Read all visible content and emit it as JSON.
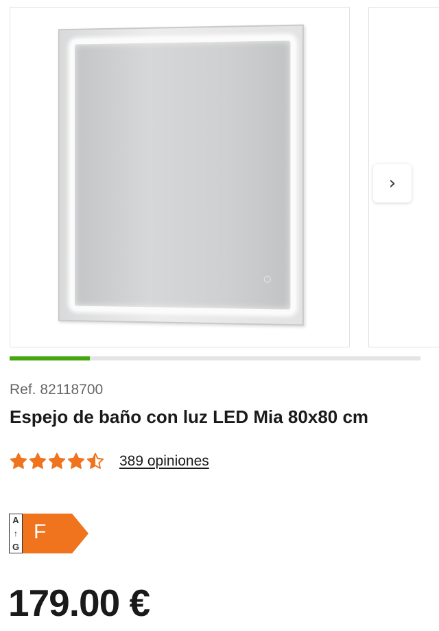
{
  "gallery": {
    "next_icon": "chevron-right-icon",
    "next_glyph": "›",
    "progress_fraction": 0.195,
    "progress_color": "#46a610"
  },
  "product": {
    "ref": "Ref. 82118700",
    "title": "Espejo de baño con luz LED Mia 80x80 cm",
    "rating_value": 4.5,
    "rating_max": 5,
    "star_color": "#f0731d",
    "reviews_link": "389 opiniones",
    "energy_scale_top": "A",
    "energy_scale_bottom": "G",
    "energy_scale_arrow": "↑",
    "energy_class": "F",
    "energy_color": "#f0731d",
    "price": "179.00 €"
  }
}
